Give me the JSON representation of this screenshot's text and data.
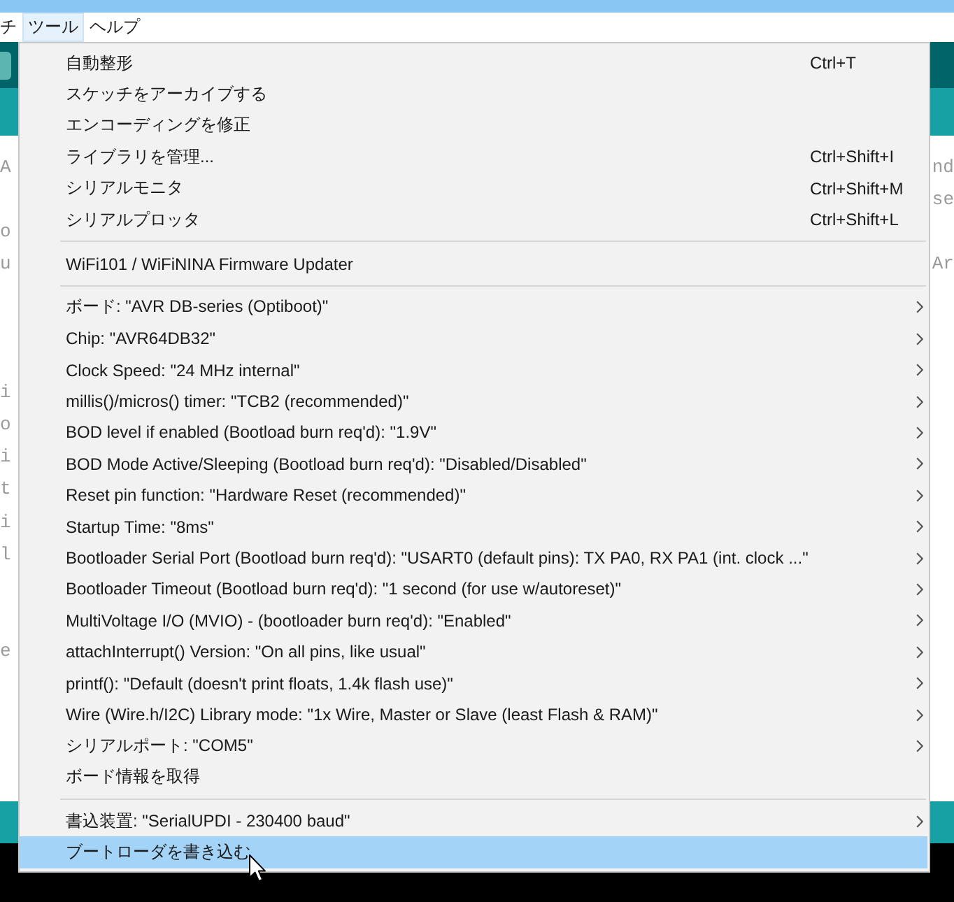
{
  "menu_bar": {
    "items": [
      {
        "label": "チ",
        "selected": false
      },
      {
        "label": "ツール",
        "selected": true
      },
      {
        "label": "ヘルプ",
        "selected": false
      }
    ]
  },
  "editor": {
    "lines": [
      {
        "kind": "code",
        "left": "A",
        "right": "nd"
      },
      {
        "kind": "code",
        "right": "se"
      },
      {
        "kind": "code",
        "left": "o"
      },
      {
        "kind": "code",
        "left": "u",
        "right": "Ar"
      },
      {
        "kind": "blank"
      },
      {
        "kind": "blank"
      },
      {
        "kind": "blank"
      },
      {
        "kind": "code",
        "left": "i"
      },
      {
        "kind": "code",
        "left": "o"
      },
      {
        "kind": "code",
        "left": "i"
      },
      {
        "kind": "code",
        "left": "t"
      },
      {
        "kind": "code",
        "left": "i"
      },
      {
        "kind": "code",
        "left": "l"
      },
      {
        "kind": "blank"
      },
      {
        "kind": "blank"
      },
      {
        "kind": "code",
        "left": "e"
      }
    ]
  },
  "tools_menu": {
    "sections": [
      {
        "items": [
          {
            "label": "自動整形",
            "shortcut": "Ctrl+T",
            "submenu": false,
            "selected": false
          },
          {
            "label": "スケッチをアーカイブする",
            "submenu": false,
            "selected": false
          },
          {
            "label": "エンコーディングを修正",
            "submenu": false,
            "selected": false
          },
          {
            "label": "ライブラリを管理...",
            "shortcut": "Ctrl+Shift+I",
            "submenu": false,
            "selected": false
          },
          {
            "label": "シリアルモニタ",
            "shortcut": "Ctrl+Shift+M",
            "submenu": false,
            "selected": false
          },
          {
            "label": "シリアルプロッタ",
            "shortcut": "Ctrl+Shift+L",
            "submenu": false,
            "selected": false
          }
        ]
      },
      {
        "items": [
          {
            "label": "WiFi101 / WiFiNINA Firmware Updater",
            "submenu": false,
            "selected": false
          }
        ]
      },
      {
        "items": [
          {
            "label": "ボード: \"AVR DB-series (Optiboot)\"",
            "submenu": true,
            "selected": false
          },
          {
            "label": "Chip: \"AVR64DB32\"",
            "submenu": true,
            "selected": false
          },
          {
            "label": "Clock Speed: \"24 MHz internal\"",
            "submenu": true,
            "selected": false
          },
          {
            "label": "millis()/micros() timer: \"TCB2 (recommended)\"",
            "submenu": true,
            "selected": false
          },
          {
            "label": "BOD level if enabled (Bootload burn req'd): \"1.9V\"",
            "submenu": true,
            "selected": false
          },
          {
            "label": "BOD Mode Active/Sleeping (Bootload burn req'd): \"Disabled/Disabled\"",
            "submenu": true,
            "selected": false
          },
          {
            "label": "Reset pin function: \"Hardware Reset (recommended)\"",
            "submenu": true,
            "selected": false
          },
          {
            "label": "Startup Time: \"8ms\"",
            "submenu": true,
            "selected": false
          },
          {
            "label": "Bootloader Serial Port (Bootload burn req'd): \"USART0 (default pins): TX PA0, RX PA1 (int. clock ...\"",
            "submenu": true,
            "selected": false
          },
          {
            "label": "Bootloader Timeout (Bootload burn req'd): \"1 second (for use w/autoreset)\"",
            "submenu": true,
            "selected": false
          },
          {
            "label": "MultiVoltage I/O (MVIO) - (bootloader burn req'd): \"Enabled\"",
            "submenu": true,
            "selected": false
          },
          {
            "label": "attachInterrupt() Version: \"On all pins, like usual\"",
            "submenu": true,
            "selected": false
          },
          {
            "label": "printf(): \"Default (doesn't print floats, 1.4k flash use)\"",
            "submenu": true,
            "selected": false
          },
          {
            "label": "Wire (Wire.h/I2C) Library mode: \"1x Wire, Master or Slave (least Flash & RAM)\"",
            "submenu": true,
            "selected": false
          },
          {
            "label": "シリアルポート: \"COM5\"",
            "submenu": true,
            "selected": false
          },
          {
            "label": "ボード情報を取得",
            "submenu": false,
            "selected": false
          }
        ]
      },
      {
        "items": [
          {
            "label": "書込装置: \"SerialUPDI - 230400 baud\"",
            "submenu": true,
            "selected": false
          },
          {
            "label": "ブートローダを書き込む",
            "submenu": false,
            "selected": true
          }
        ]
      }
    ]
  }
}
